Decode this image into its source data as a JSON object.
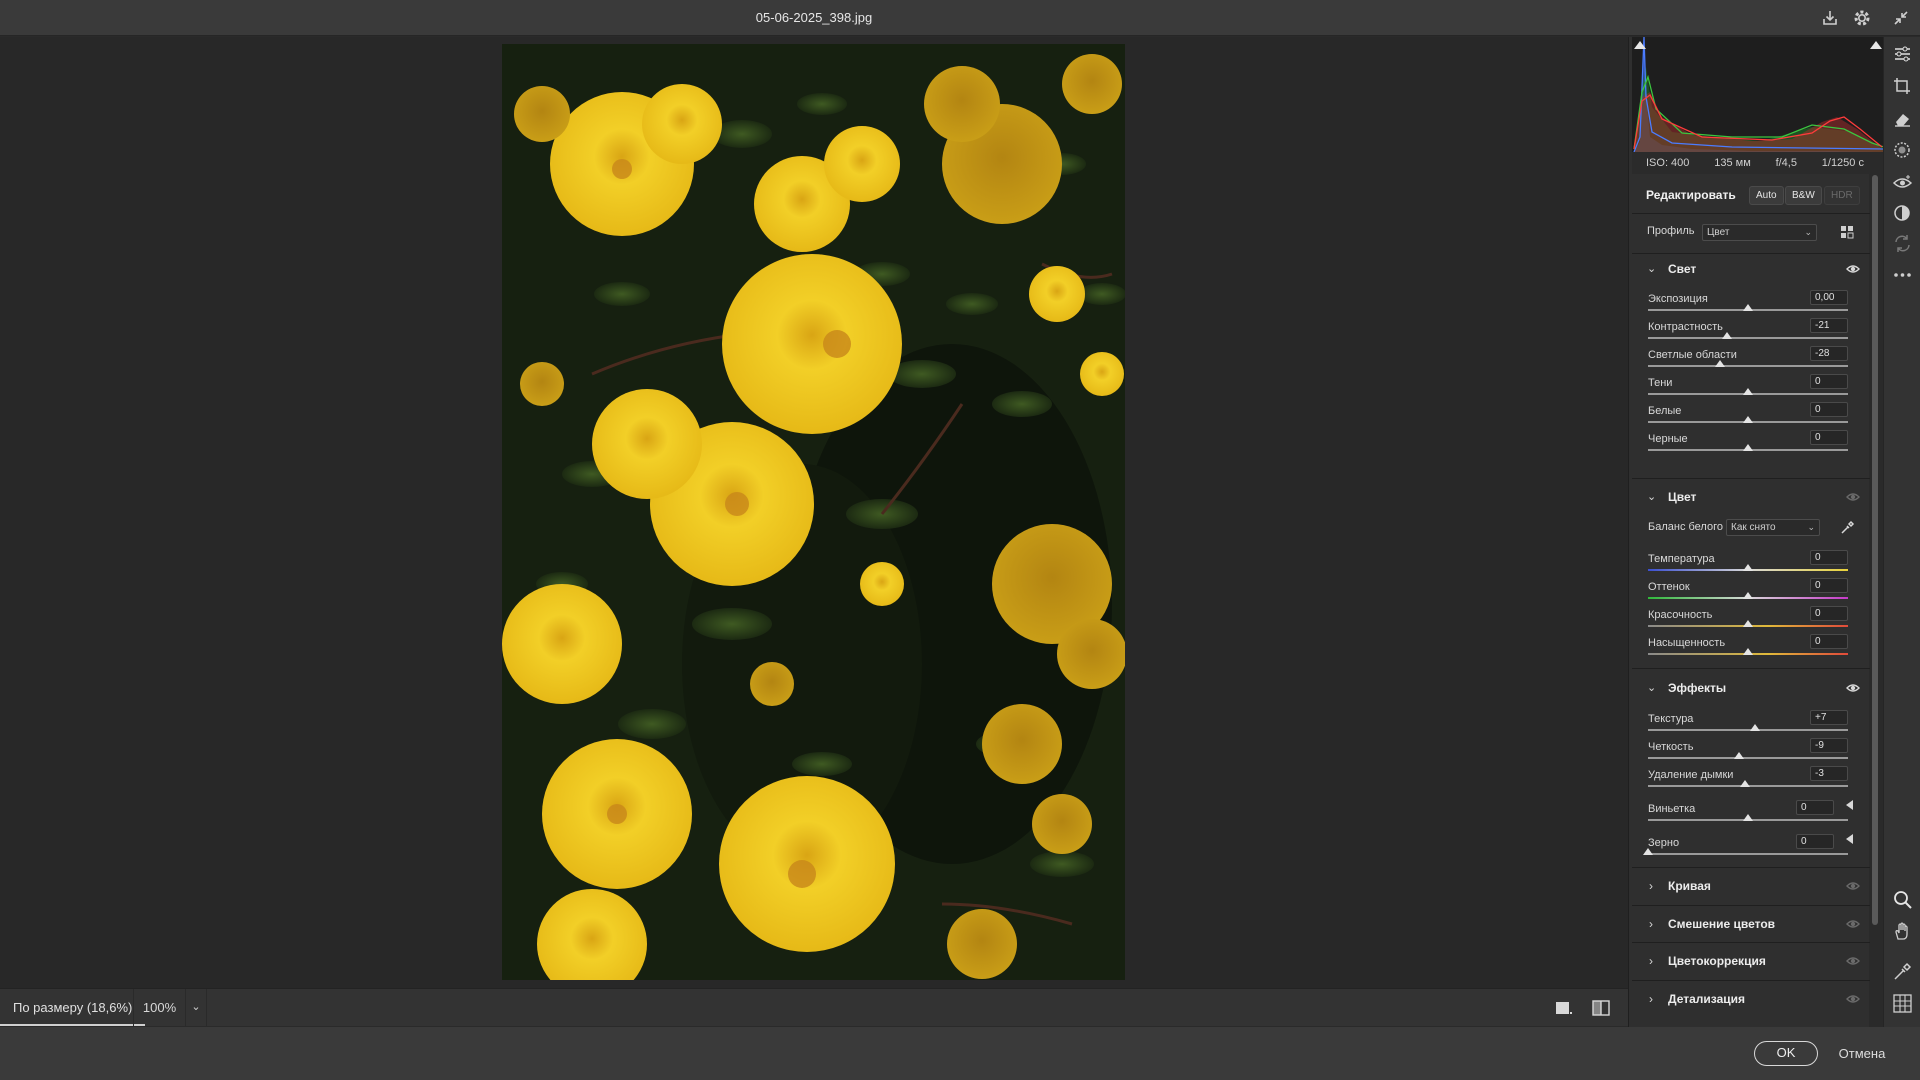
{
  "window": {
    "title": "05-06-2025_398.jpg"
  },
  "exif": {
    "iso": "ISO: 400",
    "focal": "135 мм",
    "aperture": "f/4,5",
    "shutter": "1/1250 с"
  },
  "edit": {
    "title": "Редактировать",
    "auto": "Auto",
    "bw": "B&W",
    "hdr": "HDR"
  },
  "profile": {
    "label": "Профиль",
    "value": "Цвет"
  },
  "light": {
    "title": "Свет",
    "sliders": [
      {
        "label": "Экспозиция",
        "value": "0,00",
        "pos": 0.5
      },
      {
        "label": "Контрастность",
        "value": "-21",
        "pos": 0.395
      },
      {
        "label": "Светлые области",
        "value": "-28",
        "pos": 0.36
      },
      {
        "label": "Тени",
        "value": "0",
        "pos": 0.5
      },
      {
        "label": "Белые",
        "value": "0",
        "pos": 0.5
      },
      {
        "label": "Черные",
        "value": "0",
        "pos": 0.5
      }
    ]
  },
  "color": {
    "title": "Цвет",
    "wb_label": "Баланс белого",
    "wb_value": "Как снято",
    "sliders": [
      {
        "label": "Температура",
        "value": "0",
        "pos": 0.5
      },
      {
        "label": "Оттенок",
        "value": "0",
        "pos": 0.5
      },
      {
        "label": "Красочность",
        "value": "0",
        "pos": 0.5
      },
      {
        "label": "Насыщенность",
        "value": "0",
        "pos": 0.5
      }
    ]
  },
  "effects": {
    "title": "Эффекты",
    "sliders": [
      {
        "label": "Текстура",
        "value": "+7",
        "pos": 0.535
      },
      {
        "label": "Четкость",
        "value": "-9",
        "pos": 0.455
      },
      {
        "label": "Удаление дымки",
        "value": "-3",
        "pos": 0.485
      },
      {
        "label": "Виньетка",
        "value": "0",
        "pos": 0.5
      },
      {
        "label": "Зерно",
        "value": "0",
        "pos": 0.0
      }
    ]
  },
  "collapsed": [
    "Кривая",
    "Смешение цветов",
    "Цветокоррекция",
    "Детализация"
  ],
  "bottom": {
    "zoom_fit": "По размеру (18,6%)",
    "zoom_100": "100%"
  },
  "footer": {
    "ok": "OK",
    "cancel": "Отмена"
  }
}
